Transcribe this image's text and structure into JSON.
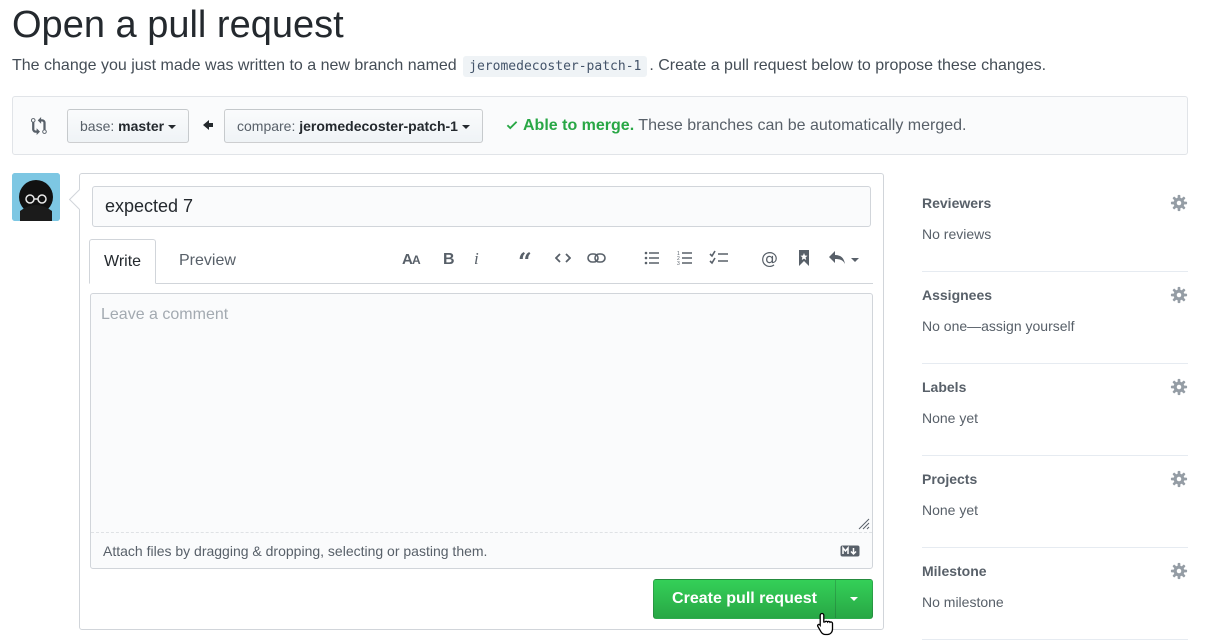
{
  "header": {
    "title": "Open a pull request",
    "subtitle_before": "The change you just made was written to a new branch named",
    "branch_name": "jeromedecoster-patch-1",
    "subtitle_after": ". Create a pull request below to propose these changes."
  },
  "range": {
    "base_prefix": "base:",
    "base_branch": "master",
    "compare_prefix": "compare:",
    "compare_branch": "jeromedecoster-patch-1",
    "merge_ok": "Able to merge.",
    "merge_msg": "These branches can be automatically merged."
  },
  "form": {
    "title_value": "expected 7",
    "tabs": [
      "Write",
      "Preview"
    ],
    "comment_placeholder": "Leave a comment",
    "attach_text": "Attach files by dragging & dropping, selecting or pasting them.",
    "toolbar_icons": [
      "text-size-icon",
      "bold-icon",
      "italic-icon",
      "quote-icon",
      "code-icon",
      "link-icon",
      "bullet-list-icon",
      "numbered-list-icon",
      "task-list-icon",
      "mention-icon",
      "bookmark-icon",
      "reply-icon"
    ],
    "submit_label": "Create pull request"
  },
  "sidebar": {
    "items": [
      {
        "heading": "Reviewers",
        "value": "No reviews"
      },
      {
        "heading": "Assignees",
        "value": "No one—assign yourself"
      },
      {
        "heading": "Labels",
        "value": "None yet"
      },
      {
        "heading": "Projects",
        "value": "None yet"
      },
      {
        "heading": "Milestone",
        "value": "No milestone"
      }
    ]
  },
  "colors": {
    "success": "#28a745",
    "button_top": "#34d058",
    "avatar_bg": "#7dc7e3"
  }
}
